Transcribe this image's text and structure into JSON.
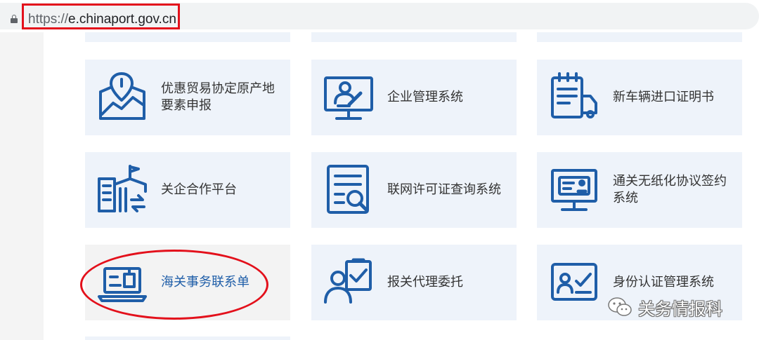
{
  "browser": {
    "url_scheme": "https://",
    "url_host": "e.chinaport.gov.cn"
  },
  "cards": [
    {
      "label": "优惠贸易协定原产地\n要素申报",
      "icon": "map-location-chart-icon"
    },
    {
      "label": "企业管理系统",
      "icon": "monitor-user-icon"
    },
    {
      "label": "新车辆进口证明书",
      "icon": "clipboard-truck-icon"
    },
    {
      "label": "关企合作平台",
      "icon": "building-flag-icon"
    },
    {
      "label": "联网许可证查询系统",
      "icon": "document-search-icon"
    },
    {
      "label": "通关无纸化协议签约\n系统",
      "icon": "monitor-id-card-icon"
    },
    {
      "label": "海关事务联系单",
      "icon": "laptop-document-icon"
    },
    {
      "label": "报关代理委托",
      "icon": "person-checklist-icon"
    },
    {
      "label": "身份认证管理系统",
      "icon": "id-card-check-icon"
    }
  ],
  "watermark": {
    "text": "关务情报科",
    "icon": "wechat-icon"
  },
  "colors": {
    "icon": "#1f5ea8",
    "card_bg": "#eef3fa",
    "highlight": "#e3101b"
  }
}
